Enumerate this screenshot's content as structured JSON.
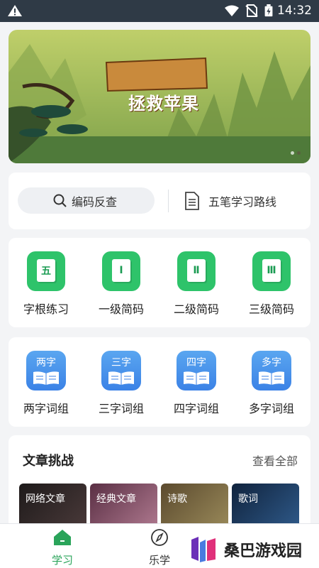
{
  "status": {
    "time": "14:32"
  },
  "banner": {
    "title": "拯救苹果",
    "dots": 2,
    "active_dot": 1
  },
  "search": {
    "lookup_label": "编码反查",
    "route_label": "五笔学习路线"
  },
  "grid1": {
    "items": [
      {
        "glyph": "五",
        "label": "字根练习"
      },
      {
        "glyph": "Ⅰ",
        "label": "一级简码"
      },
      {
        "glyph": "Ⅱ",
        "label": "二级简码"
      },
      {
        "glyph": "Ⅲ",
        "label": "三级简码"
      }
    ]
  },
  "grid2": {
    "items": [
      {
        "word": "两字",
        "label": "两字词组"
      },
      {
        "word": "三字",
        "label": "三字词组"
      },
      {
        "word": "四字",
        "label": "四字词组"
      },
      {
        "word": "多字",
        "label": "多字词组"
      }
    ]
  },
  "articles": {
    "title": "文章挑战",
    "see_all": "查看全部",
    "tiles": [
      {
        "label": "网络文章"
      },
      {
        "label": "经典文章"
      },
      {
        "label": "诗歌"
      },
      {
        "label": "歌词"
      }
    ]
  },
  "tabbar": {
    "tabs": [
      {
        "label": "学习"
      },
      {
        "label": "乐学"
      }
    ]
  },
  "watermark": {
    "text": "桑巴游戏园"
  },
  "colors": {
    "accent": "#2ec36a",
    "blue": "#3b82e6",
    "statusbar": "#2f3a46"
  }
}
